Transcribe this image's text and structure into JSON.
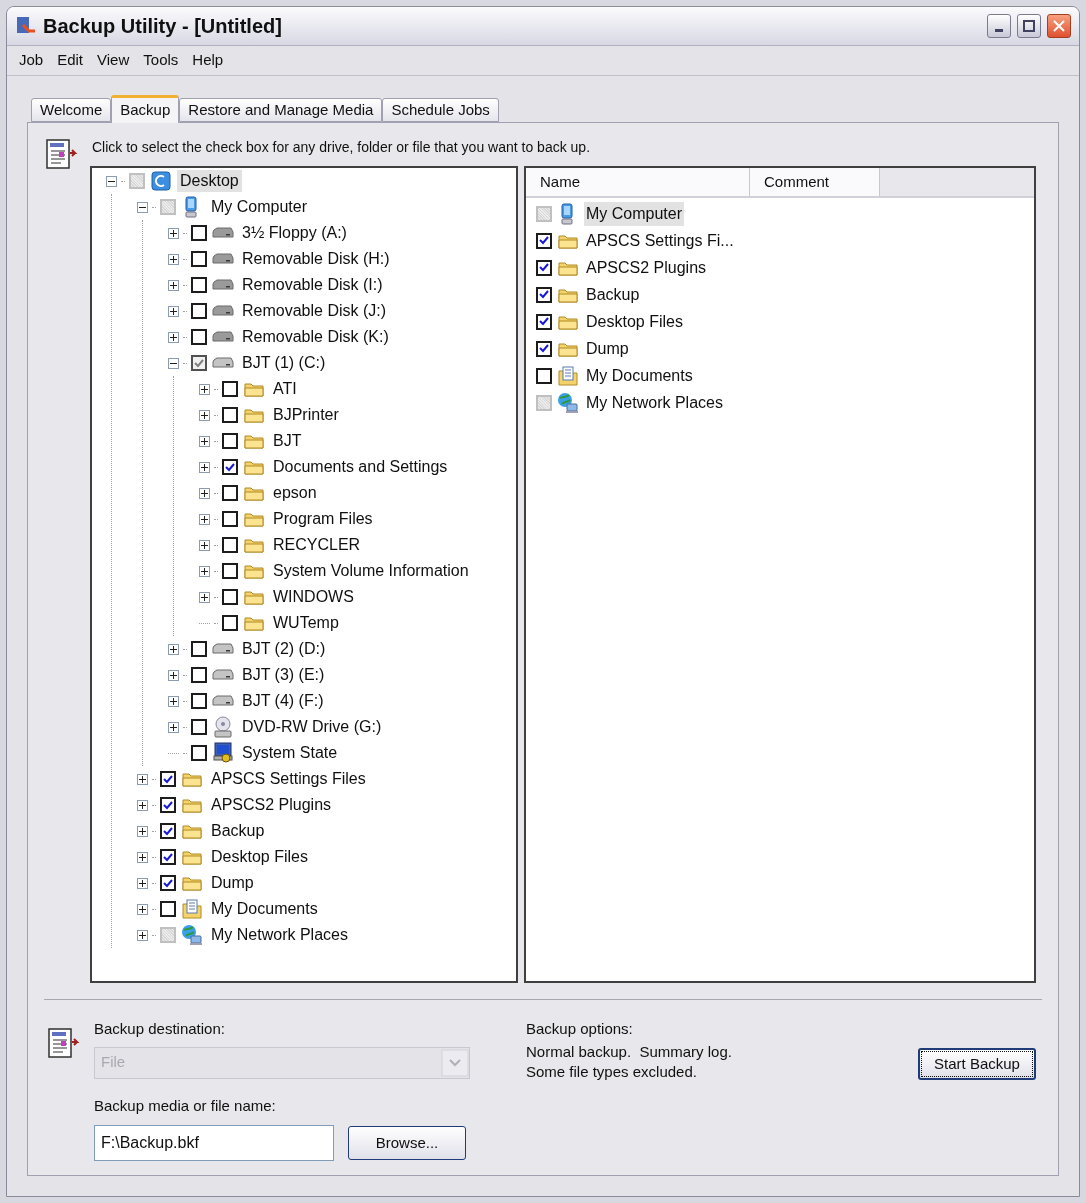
{
  "window": {
    "title": "Backup Utility - [Untitled]"
  },
  "menu": [
    "Job",
    "Edit",
    "View",
    "Tools",
    "Help"
  ],
  "tabs": [
    {
      "label": "Welcome",
      "selected": false
    },
    {
      "label": "Backup",
      "selected": true
    },
    {
      "label": "Restore and Manage Media",
      "selected": false
    },
    {
      "label": "Schedule Jobs",
      "selected": false
    }
  ],
  "instruction": "Click to select the check box for any drive, folder or file that you want to back up.",
  "tree": [
    {
      "label": "Desktop",
      "kind": "desktop",
      "checked": false,
      "partial": true,
      "expanded": true,
      "selected": true,
      "children": [
        {
          "label": "My Computer",
          "kind": "computer",
          "checked": false,
          "partial": true,
          "expanded": true,
          "selected": false,
          "children": [
            {
              "label": "3½ Floppy (A:)",
              "kind": "removable",
              "checked": false,
              "partial": false,
              "expanded": false,
              "selected": false
            },
            {
              "label": "Removable Disk (H:)",
              "kind": "removable",
              "checked": false,
              "partial": false,
              "expanded": false,
              "selected": false
            },
            {
              "label": "Removable Disk (I:)",
              "kind": "removable",
              "checked": false,
              "partial": false,
              "expanded": false,
              "selected": false
            },
            {
              "label": "Removable Disk (J:)",
              "kind": "removable",
              "checked": false,
              "partial": false,
              "expanded": false,
              "selected": false
            },
            {
              "label": "Removable Disk (K:)",
              "kind": "removable",
              "checked": false,
              "partial": false,
              "expanded": false,
              "selected": false
            },
            {
              "label": "BJT (1) (C:)",
              "kind": "drive",
              "checked": true,
              "partial": true,
              "expanded": true,
              "selected": false,
              "children": [
                {
                  "label": "ATI",
                  "kind": "folder",
                  "checked": false,
                  "partial": false,
                  "expanded": false,
                  "selected": false
                },
                {
                  "label": "BJPrinter",
                  "kind": "folder",
                  "checked": false,
                  "partial": false,
                  "expanded": false,
                  "selected": false
                },
                {
                  "label": "BJT",
                  "kind": "folder",
                  "checked": false,
                  "partial": false,
                  "expanded": false,
                  "selected": false
                },
                {
                  "label": "Documents and Settings",
                  "kind": "folder",
                  "checked": true,
                  "partial": false,
                  "expanded": false,
                  "selected": false
                },
                {
                  "label": "epson",
                  "kind": "folder",
                  "checked": false,
                  "partial": false,
                  "expanded": false,
                  "selected": false
                },
                {
                  "label": "Program Files",
                  "kind": "folder",
                  "checked": false,
                  "partial": false,
                  "expanded": false,
                  "selected": false
                },
                {
                  "label": "RECYCLER",
                  "kind": "folder",
                  "checked": false,
                  "partial": false,
                  "expanded": false,
                  "selected": false
                },
                {
                  "label": "System Volume Information",
                  "kind": "folder",
                  "checked": false,
                  "partial": false,
                  "expanded": false,
                  "selected": false
                },
                {
                  "label": "WINDOWS",
                  "kind": "folder",
                  "checked": false,
                  "partial": false,
                  "expanded": false,
                  "selected": false
                },
                {
                  "label": "WUTemp",
                  "kind": "folder",
                  "checked": false,
                  "partial": false,
                  "selected": false
                }
              ]
            },
            {
              "label": "BJT (2) (D:)",
              "kind": "drive",
              "checked": false,
              "partial": false,
              "expanded": false,
              "selected": false
            },
            {
              "label": "BJT (3) (E:)",
              "kind": "drive",
              "checked": false,
              "partial": false,
              "expanded": false,
              "selected": false
            },
            {
              "label": "BJT (4) (F:)",
              "kind": "drive",
              "checked": false,
              "partial": false,
              "expanded": false,
              "selected": false
            },
            {
              "label": "DVD-RW Drive (G:)",
              "kind": "dvd",
              "checked": false,
              "partial": false,
              "expanded": false,
              "selected": false
            },
            {
              "label": "System State",
              "kind": "system",
              "checked": false,
              "partial": false,
              "selected": false
            }
          ]
        },
        {
          "label": "APSCS Settings Files",
          "kind": "folder",
          "checked": true,
          "partial": false,
          "expanded": false,
          "selected": false
        },
        {
          "label": "APSCS2 Plugins",
          "kind": "folder",
          "checked": true,
          "partial": false,
          "expanded": false,
          "selected": false
        },
        {
          "label": "Backup",
          "kind": "folder",
          "checked": true,
          "partial": false,
          "expanded": false,
          "selected": false
        },
        {
          "label": "Desktop Files",
          "kind": "folder",
          "checked": true,
          "partial": false,
          "expanded": false,
          "selected": false
        },
        {
          "label": "Dump",
          "kind": "folder",
          "checked": true,
          "partial": false,
          "expanded": false,
          "selected": false
        },
        {
          "label": "My Documents",
          "kind": "documents",
          "checked": false,
          "partial": false,
          "expanded": false,
          "selected": false
        },
        {
          "label": "My Network Places",
          "kind": "network",
          "checked": false,
          "partial": true,
          "expanded": false,
          "selected": false
        }
      ]
    }
  ],
  "list": {
    "columns": [
      "Name",
      "Comment"
    ],
    "rows": [
      {
        "name": "My Computer",
        "kind": "computer",
        "checked": false,
        "partial": true,
        "selected": true
      },
      {
        "name": "APSCS Settings Fi...",
        "kind": "folder",
        "checked": true,
        "partial": false,
        "selected": false
      },
      {
        "name": "APSCS2 Plugins",
        "kind": "folder",
        "checked": true,
        "partial": false,
        "selected": false
      },
      {
        "name": "Backup",
        "kind": "folder",
        "checked": true,
        "partial": false,
        "selected": false
      },
      {
        "name": "Desktop Files",
        "kind": "folder",
        "checked": true,
        "partial": false,
        "selected": false
      },
      {
        "name": "Dump",
        "kind": "folder",
        "checked": true,
        "partial": false,
        "selected": false
      },
      {
        "name": "My Documents",
        "kind": "documents",
        "checked": false,
        "partial": false,
        "selected": false
      },
      {
        "name": "My Network Places",
        "kind": "network",
        "checked": false,
        "partial": true,
        "selected": false
      }
    ]
  },
  "destination": {
    "label": "Backup destination:",
    "value": "File",
    "disabled": true
  },
  "media": {
    "label": "Backup media or file name:",
    "value": "F:\\Backup.bkf",
    "browse": "Browse..."
  },
  "options": {
    "label": "Backup options:",
    "lines": [
      "Normal backup.  Summary log.",
      "Some file types excluded."
    ]
  },
  "start_button": "Start Backup"
}
